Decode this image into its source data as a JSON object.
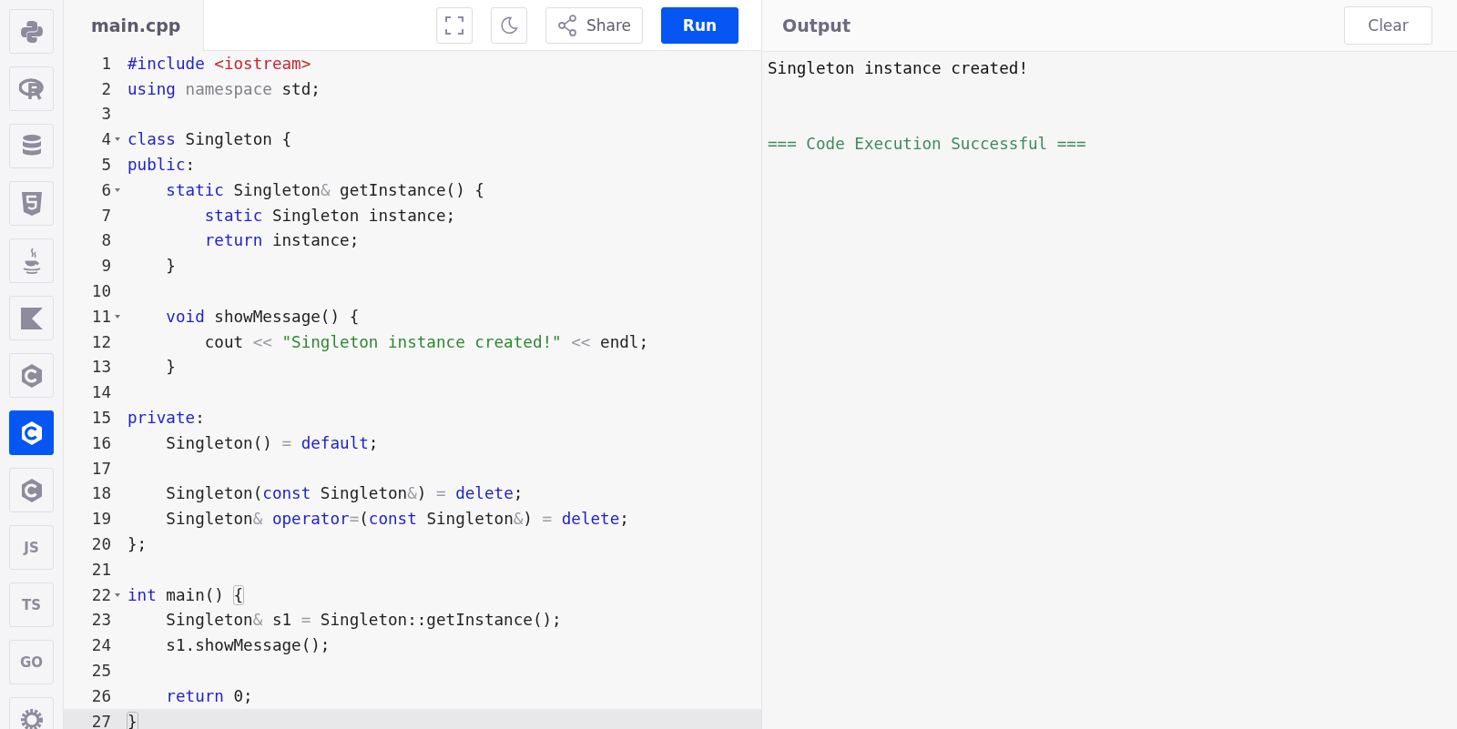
{
  "sidebar": {
    "items": [
      {
        "kind": "python",
        "selected": false
      },
      {
        "kind": "r",
        "selected": false
      },
      {
        "kind": "database",
        "selected": false
      },
      {
        "kind": "html5",
        "selected": false
      },
      {
        "kind": "java",
        "selected": false
      },
      {
        "kind": "kotlin",
        "selected": false
      },
      {
        "kind": "c",
        "selected": false
      },
      {
        "kind": "cpp",
        "selected": true
      },
      {
        "kind": "csharp",
        "selected": false
      },
      {
        "kind": "text",
        "label": "JS",
        "selected": false
      },
      {
        "kind": "text",
        "label": "TS",
        "selected": false
      },
      {
        "kind": "text",
        "label": "GO",
        "selected": false
      },
      {
        "kind": "rust",
        "selected": false
      }
    ]
  },
  "editor": {
    "tab": "main.cpp",
    "toolbar": [
      {
        "kind": "fullscreen"
      },
      {
        "kind": "theme"
      },
      {
        "kind": "share",
        "label": "Share"
      },
      {
        "kind": "run",
        "label": "Run"
      }
    ],
    "lines": [
      {
        "number": "1",
        "foldable": false,
        "highlighted": false,
        "tokens": [
          {
            "kind": "keyword",
            "text": "#include "
          },
          {
            "kind": "include",
            "text": "<iostream>"
          }
        ]
      },
      {
        "number": "2",
        "foldable": false,
        "highlighted": false,
        "tokens": [
          {
            "kind": "keyword",
            "text": "using"
          },
          {
            "kind": "namespace",
            "text": " namespace"
          },
          {
            "kind": "plain",
            "text": " std;"
          }
        ]
      },
      {
        "number": "3",
        "foldable": false,
        "highlighted": false
      },
      {
        "number": "4",
        "foldable": true,
        "highlighted": false,
        "tokens": [
          {
            "kind": "keyword",
            "text": "class"
          },
          {
            "kind": "plain",
            "text": " Singleton {"
          }
        ]
      },
      {
        "number": "5",
        "foldable": false,
        "highlighted": false,
        "tokens": [
          {
            "kind": "keyword",
            "text": "public"
          },
          {
            "kind": "plain",
            "text": ":"
          }
        ]
      },
      {
        "number": "6",
        "foldable": true,
        "highlighted": false,
        "tokens": [
          {
            "kind": "keyword",
            "text": "    static"
          },
          {
            "kind": "plain",
            "text": " Singleton"
          },
          {
            "kind": "operator",
            "text": "&"
          },
          {
            "kind": "plain",
            "text": " getInstance() {"
          }
        ]
      },
      {
        "number": "7",
        "foldable": false,
        "highlighted": false,
        "tokens": [
          {
            "kind": "keyword",
            "text": "        static"
          },
          {
            "kind": "plain",
            "text": " Singleton instance;"
          }
        ]
      },
      {
        "number": "8",
        "foldable": false,
        "highlighted": false,
        "tokens": [
          {
            "kind": "keyword",
            "text": "        return"
          },
          {
            "kind": "plain",
            "text": " instance;"
          }
        ]
      },
      {
        "number": "9",
        "foldable": false,
        "highlighted": false,
        "tokens": [
          {
            "kind": "plain",
            "text": "    }"
          }
        ]
      },
      {
        "number": "10",
        "foldable": false,
        "highlighted": false
      },
      {
        "number": "11",
        "foldable": true,
        "highlighted": false,
        "tokens": [
          {
            "kind": "keyword",
            "text": "    void"
          },
          {
            "kind": "plain",
            "text": " showMessage() {"
          }
        ]
      },
      {
        "number": "12",
        "foldable": false,
        "highlighted": false,
        "tokens": [
          {
            "kind": "plain",
            "text": "        cout "
          },
          {
            "kind": "operator",
            "text": "<<"
          },
          {
            "kind": "string",
            "text": " \"Singleton instance created!\" "
          },
          {
            "kind": "operator",
            "text": "<<"
          },
          {
            "kind": "plain",
            "text": " endl;"
          }
        ]
      },
      {
        "number": "13",
        "foldable": false,
        "highlighted": false,
        "tokens": [
          {
            "kind": "plain",
            "text": "    }"
          }
        ]
      },
      {
        "number": "14",
        "foldable": false,
        "highlighted": false
      },
      {
        "number": "15",
        "foldable": false,
        "highlighted": false,
        "tokens": [
          {
            "kind": "keyword",
            "text": "private"
          },
          {
            "kind": "plain",
            "text": ":"
          }
        ]
      },
      {
        "number": "16",
        "foldable": false,
        "highlighted": false,
        "tokens": [
          {
            "kind": "plain",
            "text": "    Singleton() "
          },
          {
            "kind": "operator",
            "text": "="
          },
          {
            "kind": "keyword",
            "text": " default"
          },
          {
            "kind": "plain",
            "text": ";"
          }
        ]
      },
      {
        "number": "17",
        "foldable": false,
        "highlighted": false
      },
      {
        "number": "18",
        "foldable": false,
        "highlighted": false,
        "tokens": [
          {
            "kind": "plain",
            "text": "    Singleton("
          },
          {
            "kind": "keyword",
            "text": "const"
          },
          {
            "kind": "plain",
            "text": " Singleton"
          },
          {
            "kind": "operator",
            "text": "&"
          },
          {
            "kind": "plain",
            "text": ") "
          },
          {
            "kind": "operator",
            "text": "="
          },
          {
            "kind": "keyword",
            "text": " delete"
          },
          {
            "kind": "plain",
            "text": ";"
          }
        ]
      },
      {
        "number": "19",
        "foldable": false,
        "highlighted": false,
        "tokens": [
          {
            "kind": "plain",
            "text": "    Singleton"
          },
          {
            "kind": "operator",
            "text": "&"
          },
          {
            "kind": "keyword",
            "text": " operator"
          },
          {
            "kind": "operator",
            "text": "="
          },
          {
            "kind": "plain",
            "text": "("
          },
          {
            "kind": "keyword",
            "text": "const"
          },
          {
            "kind": "plain",
            "text": " Singleton"
          },
          {
            "kind": "operator",
            "text": "&"
          },
          {
            "kind": "plain",
            "text": ") "
          },
          {
            "kind": "operator",
            "text": "="
          },
          {
            "kind": "keyword",
            "text": " delete"
          },
          {
            "kind": "plain",
            "text": ";"
          }
        ]
      },
      {
        "number": "20",
        "foldable": false,
        "highlighted": false,
        "tokens": [
          {
            "kind": "plain",
            "text": "};"
          }
        ]
      },
      {
        "number": "21",
        "foldable": false,
        "highlighted": false
      },
      {
        "number": "22",
        "foldable": true,
        "highlighted": false,
        "tokens": [
          {
            "kind": "keyword",
            "text": "int"
          },
          {
            "kind": "plain",
            "text": " main() "
          },
          {
            "kind": "bracket_match",
            "text": "{"
          }
        ]
      },
      {
        "number": "23",
        "foldable": false,
        "highlighted": false,
        "tokens": [
          {
            "kind": "plain",
            "text": "    Singleton"
          },
          {
            "kind": "operator",
            "text": "&"
          },
          {
            "kind": "plain",
            "text": " s1 "
          },
          {
            "kind": "operator",
            "text": "="
          },
          {
            "kind": "plain",
            "text": " Singleton::getInstance();"
          }
        ]
      },
      {
        "number": "24",
        "foldable": false,
        "highlighted": false,
        "tokens": [
          {
            "kind": "plain",
            "text": "    s1.showMessage();"
          }
        ]
      },
      {
        "number": "25",
        "foldable": false,
        "highlighted": false
      },
      {
        "number": "26",
        "foldable": false,
        "highlighted": false,
        "tokens": [
          {
            "kind": "keyword",
            "text": "    return"
          },
          {
            "kind": "plain",
            "text": " 0;"
          }
        ]
      },
      {
        "number": "27",
        "foldable": false,
        "highlighted": true,
        "tokens": [
          {
            "kind": "bracket_match",
            "text": "}"
          }
        ]
      }
    ]
  },
  "output": {
    "title": "Output",
    "clear": "Clear",
    "lines": [
      {
        "kind": "stdout",
        "text": "Singleton instance created!"
      },
      {
        "kind": "success",
        "text": "=== Code Execution Successful ==="
      }
    ]
  }
}
